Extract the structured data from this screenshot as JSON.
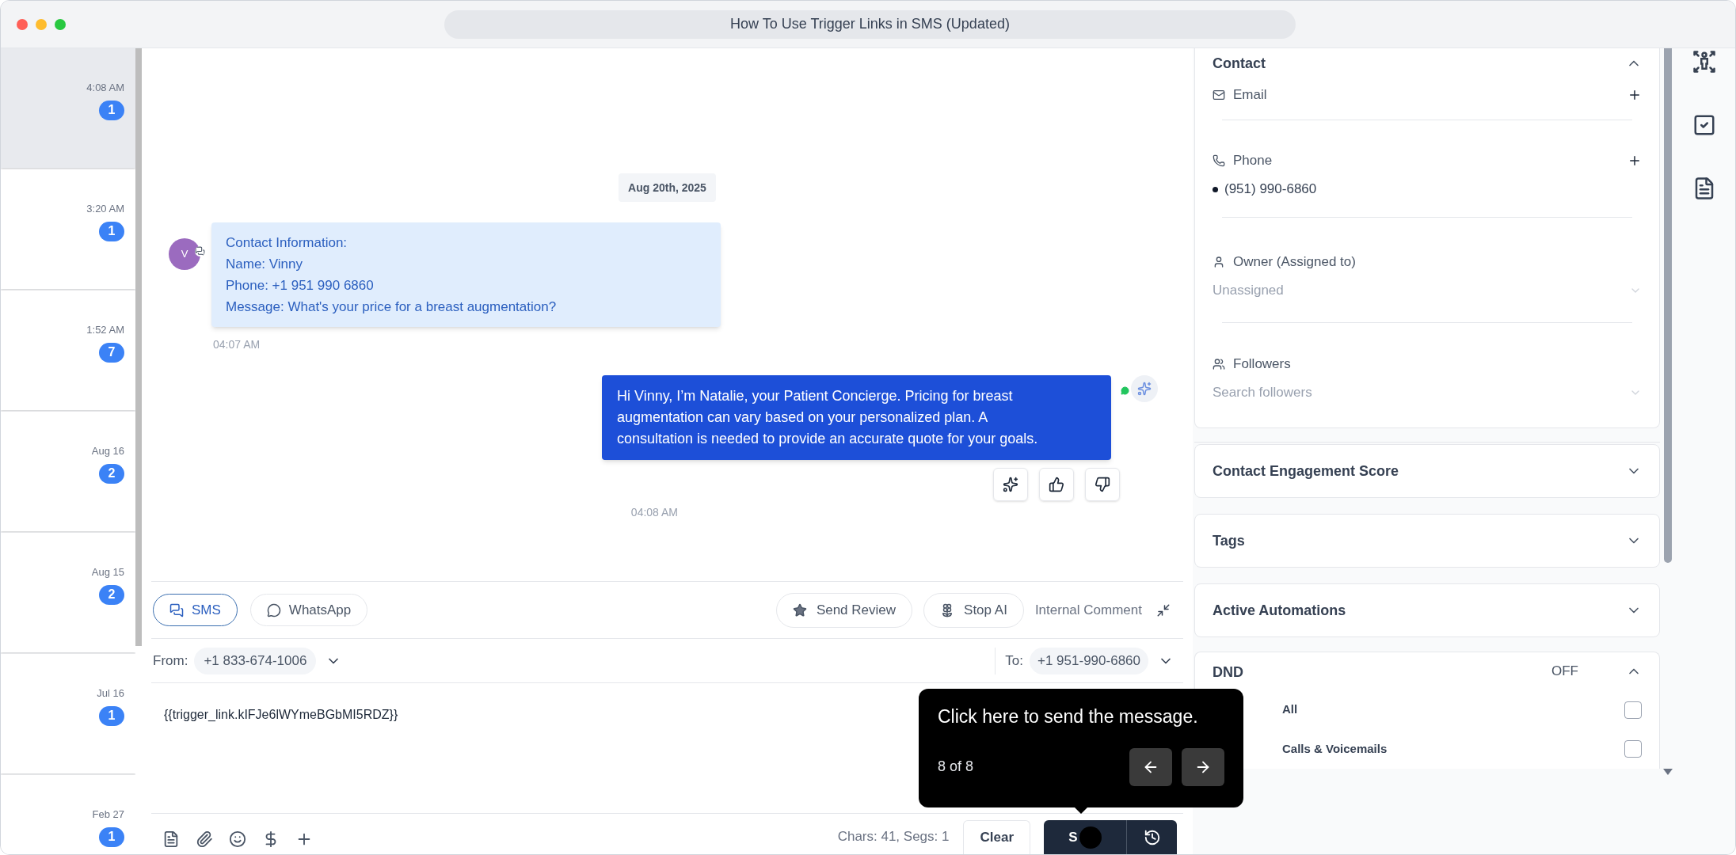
{
  "window": {
    "title": "How To Use Trigger Links in SMS (Updated)"
  },
  "conversations": [
    {
      "time": "4:08 AM",
      "count": "1",
      "selected": true
    },
    {
      "time": "3:20 AM",
      "count": "1",
      "selected": false
    },
    {
      "time": "1:52 AM",
      "count": "7",
      "selected": false
    },
    {
      "time": "Aug 16",
      "count": "2",
      "selected": false
    },
    {
      "time": "Aug 15",
      "count": "2",
      "selected": false
    },
    {
      "time": "Jul 16",
      "count": "1",
      "selected": false
    },
    {
      "time": "Feb 27",
      "count": "1",
      "selected": false
    }
  ],
  "date_divider": "Aug 20th, 2025",
  "messages": [
    {
      "kind": "incoming",
      "avatar": "V",
      "text": "Contact Information:\nName: Vinny\nPhone: +1 951 990 6860\nMessage: What's your price for a breast augmentation?",
      "time": "04:07 AM"
    },
    {
      "kind": "outgoing",
      "text": "Hi Vinny, I’m Natalie, your Patient Concierge. Pricing for breast augmentation can vary based on your personalized plan. A consultation is needed to provide an accurate quote for your goals.",
      "time": "04:08 AM"
    }
  ],
  "composer": {
    "channels": [
      {
        "label": "SMS",
        "selected": true
      },
      {
        "label": "WhatsApp",
        "selected": false
      }
    ],
    "actions": [
      {
        "kind": "review",
        "label": "Send Review"
      },
      {
        "kind": "stop_ai",
        "label": "Stop AI"
      }
    ],
    "internal_comment": "Internal Comment",
    "from_label": "From:",
    "from_number": "+1 833-674-1006",
    "to_label": "To:",
    "to_number": "+1 951-990-6860",
    "message": "{{trigger_link.kIFJe6lWYmeBGbMI5RDZ}}",
    "counter": "Chars: 41, Segs: 1",
    "clear": "Clear",
    "send": "S"
  },
  "tour_tooltip": {
    "text": "Click here to send the message.",
    "step": "8 of 8"
  },
  "contact": {
    "title": "Contact",
    "expanded": true,
    "email_label": "Email",
    "phone_label": "Phone",
    "phones": [
      "(951) 990-6860"
    ],
    "owner_label": "Owner (Assigned to)",
    "owner_value": "Unassigned",
    "followers_label": "Followers",
    "followers_placeholder": "Search followers"
  },
  "sections": [
    {
      "title": "Contact Engagement Score",
      "expanded": false
    },
    {
      "title": "Tags",
      "expanded": false
    },
    {
      "title": "Active Automations",
      "expanded": false
    }
  ],
  "dnd": {
    "title": "DND",
    "status": "OFF",
    "expanded": true,
    "options": [
      {
        "label": "All",
        "checked": false
      },
      {
        "label": "Calls & Voicemails",
        "checked": false
      }
    ]
  }
}
